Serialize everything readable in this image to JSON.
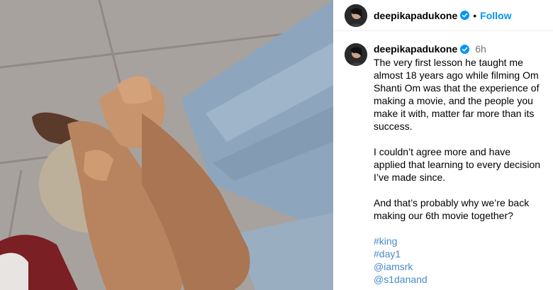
{
  "post": {
    "username": "deepikapadukone",
    "follow_label": "Follow",
    "separator": "•",
    "time": "6h",
    "caption": {
      "p1": "The very first lesson he taught me almost 18 years ago while filming Om Shanti Om was that the experience of making a movie, and the people you make it with, matter far more than its success.",
      "p2": "I couldn’t agree more and have applied that learning to every decision I’ve made since.",
      "p3": "And that’s probably why we’re back making our 6th movie together?",
      "tags": [
        "#king",
        "#day1",
        "@iamsrk",
        "@s1danand"
      ]
    }
  },
  "icons": {
    "verified": "verified-badge-icon"
  },
  "colors": {
    "accent": "#0095f6",
    "link": "#4a8bc9",
    "muted": "#737373"
  }
}
